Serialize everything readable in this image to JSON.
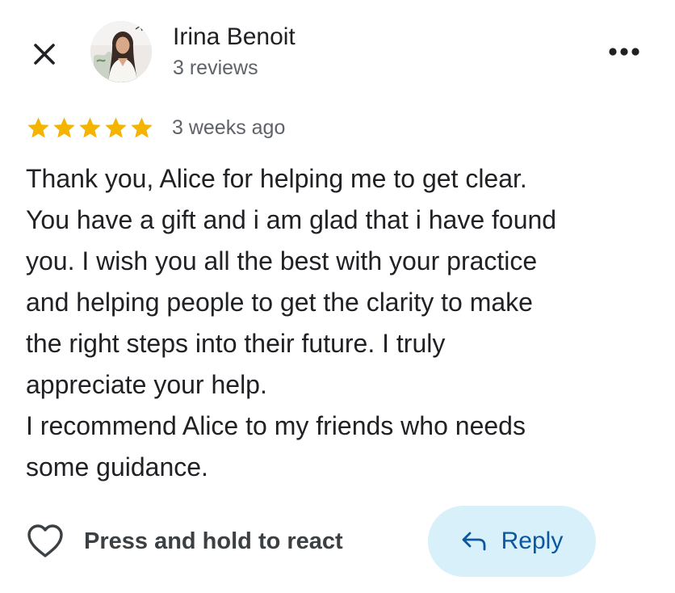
{
  "reviewer": {
    "name": "Irina Benoit",
    "reviews_count": "3 reviews"
  },
  "review": {
    "rating": 5,
    "max_rating": 5,
    "date": "3 weeks ago",
    "text": "Thank you, Alice for helping me to get clear.\nYou have a gift and i am glad that i have found\nyou. I wish you all the best with your practice\nand helping people to get the clarity to make\nthe right steps into their future. I truly\nappreciate your help.\nI recommend Alice to my friends who needs\nsome guidance."
  },
  "actions": {
    "react_label": "Press and hold to react",
    "reply_label": "Reply"
  },
  "icons": {
    "close": "close-icon",
    "more": "more-options-icon",
    "star": "star-icon",
    "heart": "heart-icon",
    "reply": "reply-arrow-icon"
  },
  "colors": {
    "star": "#f4b400",
    "reply_background": "#d8f0fa",
    "reply_text": "#0b57a0",
    "secondary_text": "#5f6368"
  }
}
